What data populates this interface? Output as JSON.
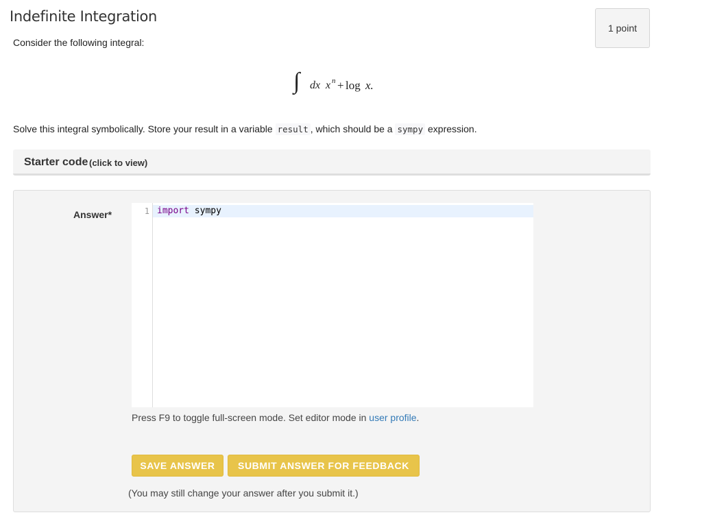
{
  "header": {
    "title": "Indefinite Integration",
    "points": "1 point"
  },
  "question": {
    "intro": "Consider the following integral:",
    "equation": {
      "integral": "∫",
      "dx": "dx",
      "x": "x",
      "exponent": "n",
      "plus": "+",
      "log": "log",
      "x_end": "x."
    },
    "prompt_parts": {
      "p1": "Solve this integral symbolically. Store your result in a variable ",
      "code1": "result",
      "p2": ", which should be a ",
      "code2": "sympy",
      "p3": " expression."
    }
  },
  "starter_code": {
    "title": "Starter code",
    "hint": "(click to view)"
  },
  "answer": {
    "label": "Answer*",
    "editor": {
      "line_number": "1",
      "keyword": "import",
      "module": " sympy"
    },
    "hint_text": "Press F9 to toggle full-screen mode. Set editor mode in ",
    "hint_link": "user profile",
    "hint_end": ".",
    "save_label": "SAVE ANSWER",
    "submit_label": "SUBMIT ANSWER FOR FEEDBACK",
    "note": "(You may still change your answer after you submit it.)"
  }
}
